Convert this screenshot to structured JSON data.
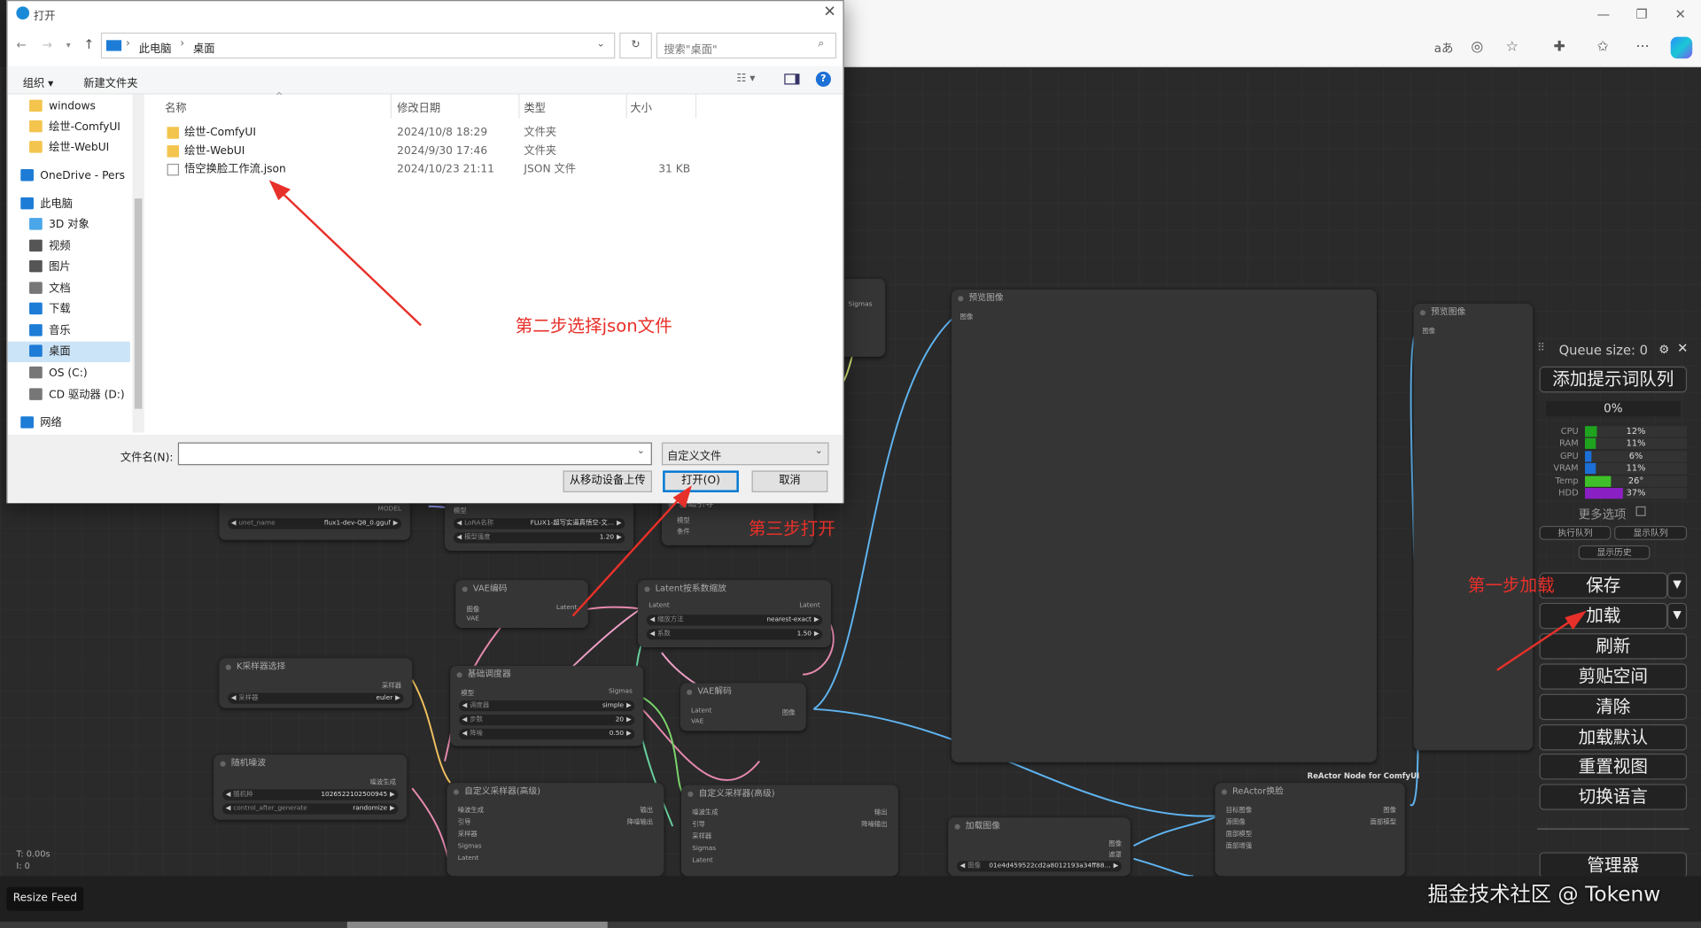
{
  "dialog": {
    "title": "打开",
    "breadcrumb": [
      "此电脑",
      "桌面"
    ],
    "search_placeholder": "搜索\"桌面\"",
    "toolbar": {
      "organize": "组织 ▾",
      "new_folder": "新建文件夹"
    },
    "nav": [
      {
        "label": "windows",
        "icon": "folder-icon"
      },
      {
        "label": "绘世-ComfyUI",
        "icon": "folder-icon"
      },
      {
        "label": "绘世-WebUI",
        "icon": "folder-icon"
      },
      {
        "label": "OneDrive - Pers",
        "icon": "cloud-icon"
      },
      {
        "label": "此电脑",
        "icon": "pc-icon"
      },
      {
        "label": "3D 对象",
        "icon": "cube-icon"
      },
      {
        "label": "视频",
        "icon": "video-icon"
      },
      {
        "label": "图片",
        "icon": "picture-icon"
      },
      {
        "label": "文档",
        "icon": "document-icon"
      },
      {
        "label": "下载",
        "icon": "download-icon"
      },
      {
        "label": "音乐",
        "icon": "music-icon"
      },
      {
        "label": "桌面",
        "icon": "desktop-icon",
        "selected": true
      },
      {
        "label": "OS (C:)",
        "icon": "drive-icon"
      },
      {
        "label": "CD 驱动器 (D:)",
        "icon": "cd-icon"
      },
      {
        "label": "网络",
        "icon": "network-icon"
      }
    ],
    "columns": [
      "名称",
      "修改日期",
      "类型",
      "大小"
    ],
    "files": [
      {
        "name": "绘世-ComfyUI",
        "date": "2024/10/8 18:29",
        "type": "文件夹",
        "size": "",
        "icon": "folder-icon"
      },
      {
        "name": "绘世-WebUI",
        "date": "2024/9/30 17:46",
        "type": "文件夹",
        "size": "",
        "icon": "folder-icon"
      },
      {
        "name": "悟空换脸工作流.json",
        "date": "2024/10/23 21:11",
        "type": "JSON 文件",
        "size": "31 KB",
        "icon": "file-icon"
      }
    ],
    "filename_label": "文件名(N):",
    "filename_value": "",
    "filetype": "自定义文件",
    "buttons": {
      "upload": "从移动设备上传",
      "open": "打开(O)",
      "cancel": "取消"
    }
  },
  "annotations": {
    "step1": "第一步加载",
    "step2": "第二步选择json文件",
    "step3": "第三步打开",
    "color": "#e8302a"
  },
  "queue": {
    "title": "Queue size: 0",
    "add_prompt": "添加提示词队列",
    "progress": "0%",
    "monitors": [
      {
        "label": "CPU",
        "value": "12%",
        "fraction": 0.12,
        "color": "#1fa31f"
      },
      {
        "label": "RAM",
        "value": "11%",
        "fraction": 0.11,
        "color": "#1fa31f"
      },
      {
        "label": "GPU",
        "value": "6%",
        "fraction": 0.06,
        "color": "#1c6fd6"
      },
      {
        "label": "VRAM",
        "value": "11%",
        "fraction": 0.11,
        "color": "#1c6fd6"
      },
      {
        "label": "Temp",
        "value": "26°",
        "fraction": 0.26,
        "color": "#3fc02a"
      },
      {
        "label": "HDD",
        "value": "37%",
        "fraction": 0.37,
        "color": "#8a1fc4"
      }
    ],
    "more_options": "更多选项",
    "execute_queue": "执行队列",
    "show_queue": "显示队列",
    "show_history": "显示历史",
    "save": "保存",
    "load": "加载",
    "refresh": "刷新",
    "clipspace": "剪贴空间",
    "clear": "清除",
    "load_default": "加载默认",
    "reset_view": "重置视图",
    "switch_language": "切换语言",
    "manager": "管理器"
  },
  "nodes": {
    "preview1": "预览图像",
    "preview1_port": "图像",
    "preview2": "预览图像",
    "preview2_port": "图像",
    "vae_encode": "VAE编码",
    "vae_decode": "VAE解码",
    "latent_scale": "Latent按系数缩放",
    "latent_scale_w": [
      {
        "l": "缩放方法",
        "v": "nearest-exact"
      },
      {
        "l": "系数",
        "v": "1.50"
      }
    ],
    "ksampler_select": "K采样器选择",
    "sampler_label": "采样器",
    "sampler_value": "euler",
    "basic_scheduler": "基础调度器",
    "sched_w": [
      {
        "l": "调度器",
        "v": "simple"
      },
      {
        "l": "步数",
        "v": "20"
      },
      {
        "l": "降噪",
        "v": "0.50"
      }
    ],
    "noise": "随机噪波",
    "noise_w": [
      {
        "l": "随机种",
        "v": "1026522102500945"
      },
      {
        "l": "control_after_generate",
        "v": "randomize"
      }
    ],
    "adv_sampler1": "自定义采样器(高级)",
    "adv_sampler2": "自定义采样器(高级)",
    "load_image": "加载图像",
    "load_image_file": "图像",
    "load_image_value": "01e4d459522cd2a8012193a34ff88…",
    "reactor": "ReActor换脸",
    "reactor_group": "ReActor Node for ComfyUI",
    "unet": "unet_name",
    "unet_value": "flux1-dev-Q8_0.gguf",
    "model_out": "MODEL",
    "lora_label": "LoRA名称",
    "lora_value": "FLUX1-超写实逼真悟空-文…",
    "lora_strength": "模型强度",
    "lora_strength_value": "1.20",
    "guider": "基础引导"
  },
  "resize_feed": "Resize Feed",
  "status": {
    "t": "T: 0.00s",
    "i": "I: 0"
  },
  "watermark": "掘金技术社区 @ Tokenw"
}
